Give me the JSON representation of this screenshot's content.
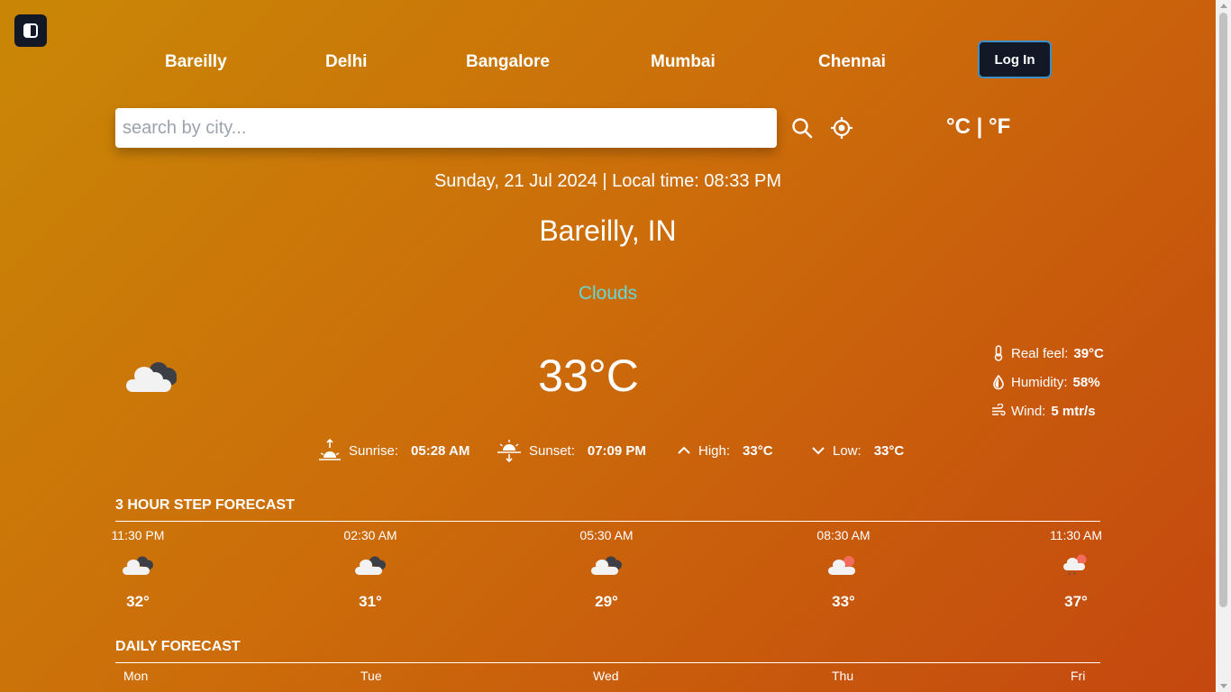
{
  "nav": {
    "cities": [
      "Bareilly",
      "Delhi",
      "Bangalore",
      "Mumbai",
      "Chennai"
    ],
    "login_label": "Log In"
  },
  "search": {
    "placeholder": "search by city...",
    "value": ""
  },
  "units": "°C | °F",
  "datetime": "Sunday, 21 Jul 2024 | Local time: 08:33 PM",
  "location": "Bareilly, IN",
  "condition": "Clouds",
  "current": {
    "temperature": "33°C",
    "icon": "cloud-icon",
    "real_feel_label": "Real feel:",
    "real_feel": "39°C",
    "humidity_label": "Humidity:",
    "humidity": "58%",
    "wind_label": "Wind:",
    "wind": "5 mtr/s"
  },
  "sun": {
    "sunrise_label": "Sunrise:",
    "sunrise": "05:28 AM",
    "sunset_label": "Sunset:",
    "sunset": "07:09 PM",
    "high_label": "High:",
    "high": "33°C",
    "low_label": "Low:",
    "low": "33°C"
  },
  "hourly": {
    "title": "3 HOUR STEP FORECAST",
    "items": [
      {
        "time": "11:30 PM",
        "temp": "32°",
        "icon": "cloud-icon"
      },
      {
        "time": "02:30 AM",
        "temp": "31°",
        "icon": "cloud-icon"
      },
      {
        "time": "05:30 AM",
        "temp": "29°",
        "icon": "cloud-icon"
      },
      {
        "time": "08:30 AM",
        "temp": "33°",
        "icon": "cloud-sun-icon"
      },
      {
        "time": "11:30 AM",
        "temp": "37°",
        "icon": "cloud-rain-sun-icon"
      }
    ]
  },
  "daily": {
    "title": "DAILY FORECAST",
    "days": [
      "Mon",
      "Tue",
      "Wed",
      "Thu",
      "Fri"
    ]
  },
  "colors": {
    "condition": "#67d7d4",
    "button_bg": "#121826",
    "button_border": "#3a8fc7"
  }
}
